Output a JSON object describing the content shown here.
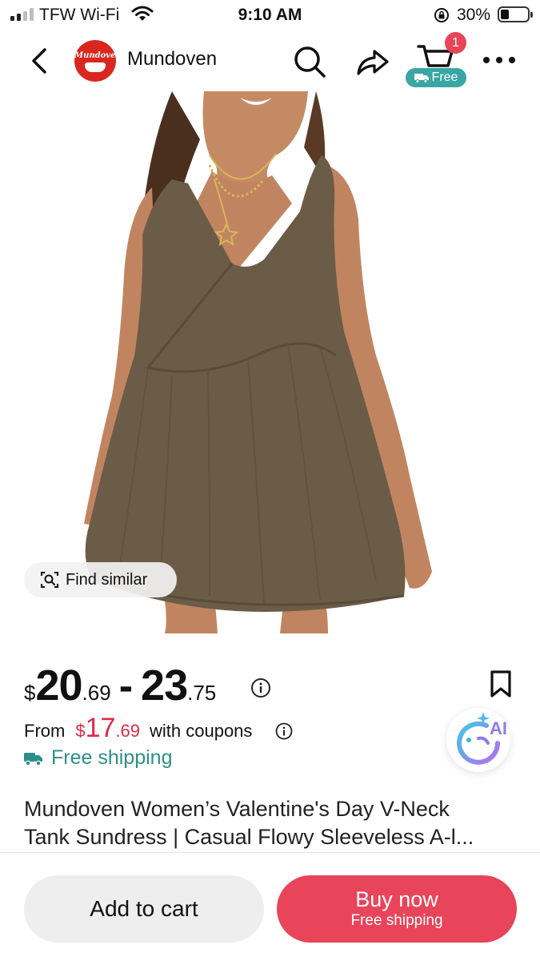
{
  "status_bar": {
    "carrier": "TFW Wi-Fi",
    "time": "9:10 AM",
    "battery": "30%",
    "battery_level": 0.3,
    "icons": [
      "signal-icon",
      "wifi-icon",
      "orientation-lock-icon",
      "battery-icon"
    ]
  },
  "nav": {
    "shop_name": "Mundoven",
    "logo_text": "Mundoven",
    "cart_count": "1",
    "cart_free_label": "Free",
    "icons": [
      "back-icon",
      "search-icon",
      "share-icon",
      "cart-icon",
      "more-icon"
    ]
  },
  "gallery": {
    "find_similar_label": "Find similar",
    "image_count": 6,
    "active_index": 2
  },
  "price": {
    "currency": "$",
    "low_whole": "20",
    "low_cents": ".69",
    "separator": "-",
    "high_whole": "23",
    "high_cents": ".75"
  },
  "coupon": {
    "from_label": "From",
    "currency": "$",
    "whole": "17",
    "cents": ".69",
    "suffix": "with coupons"
  },
  "shipping": {
    "label": "Free shipping"
  },
  "ai_assistant": {
    "label": "AI"
  },
  "product": {
    "title_line1": "Mundoven Women’s Valentine's Day V-Neck",
    "title_line2": "Tank Sundress | Casual Flowy Sleeveless A-l..."
  },
  "actions": {
    "add_to_cart": "Add to cart",
    "buy_now": "Buy now",
    "buy_now_sub": "Free shipping"
  },
  "colors": {
    "accent_red": "#e8445a",
    "coupon_red": "#e0294a",
    "teal": "#2c8f8a",
    "free_pill": "#3aa6a4"
  }
}
